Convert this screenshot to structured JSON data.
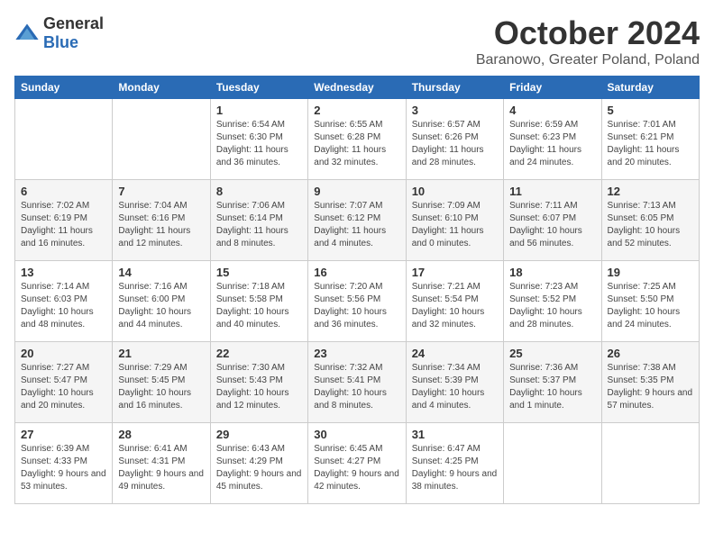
{
  "header": {
    "logo_general": "General",
    "logo_blue": "Blue",
    "month": "October 2024",
    "location": "Baranowo, Greater Poland, Poland"
  },
  "days_of_week": [
    "Sunday",
    "Monday",
    "Tuesday",
    "Wednesday",
    "Thursday",
    "Friday",
    "Saturday"
  ],
  "weeks": [
    [
      {
        "day": "",
        "info": ""
      },
      {
        "day": "",
        "info": ""
      },
      {
        "day": "1",
        "info": "Sunrise: 6:54 AM\nSunset: 6:30 PM\nDaylight: 11 hours and 36 minutes."
      },
      {
        "day": "2",
        "info": "Sunrise: 6:55 AM\nSunset: 6:28 PM\nDaylight: 11 hours and 32 minutes."
      },
      {
        "day": "3",
        "info": "Sunrise: 6:57 AM\nSunset: 6:26 PM\nDaylight: 11 hours and 28 minutes."
      },
      {
        "day": "4",
        "info": "Sunrise: 6:59 AM\nSunset: 6:23 PM\nDaylight: 11 hours and 24 minutes."
      },
      {
        "day": "5",
        "info": "Sunrise: 7:01 AM\nSunset: 6:21 PM\nDaylight: 11 hours and 20 minutes."
      }
    ],
    [
      {
        "day": "6",
        "info": "Sunrise: 7:02 AM\nSunset: 6:19 PM\nDaylight: 11 hours and 16 minutes."
      },
      {
        "day": "7",
        "info": "Sunrise: 7:04 AM\nSunset: 6:16 PM\nDaylight: 11 hours and 12 minutes."
      },
      {
        "day": "8",
        "info": "Sunrise: 7:06 AM\nSunset: 6:14 PM\nDaylight: 11 hours and 8 minutes."
      },
      {
        "day": "9",
        "info": "Sunrise: 7:07 AM\nSunset: 6:12 PM\nDaylight: 11 hours and 4 minutes."
      },
      {
        "day": "10",
        "info": "Sunrise: 7:09 AM\nSunset: 6:10 PM\nDaylight: 11 hours and 0 minutes."
      },
      {
        "day": "11",
        "info": "Sunrise: 7:11 AM\nSunset: 6:07 PM\nDaylight: 10 hours and 56 minutes."
      },
      {
        "day": "12",
        "info": "Sunrise: 7:13 AM\nSunset: 6:05 PM\nDaylight: 10 hours and 52 minutes."
      }
    ],
    [
      {
        "day": "13",
        "info": "Sunrise: 7:14 AM\nSunset: 6:03 PM\nDaylight: 10 hours and 48 minutes."
      },
      {
        "day": "14",
        "info": "Sunrise: 7:16 AM\nSunset: 6:00 PM\nDaylight: 10 hours and 44 minutes."
      },
      {
        "day": "15",
        "info": "Sunrise: 7:18 AM\nSunset: 5:58 PM\nDaylight: 10 hours and 40 minutes."
      },
      {
        "day": "16",
        "info": "Sunrise: 7:20 AM\nSunset: 5:56 PM\nDaylight: 10 hours and 36 minutes."
      },
      {
        "day": "17",
        "info": "Sunrise: 7:21 AM\nSunset: 5:54 PM\nDaylight: 10 hours and 32 minutes."
      },
      {
        "day": "18",
        "info": "Sunrise: 7:23 AM\nSunset: 5:52 PM\nDaylight: 10 hours and 28 minutes."
      },
      {
        "day": "19",
        "info": "Sunrise: 7:25 AM\nSunset: 5:50 PM\nDaylight: 10 hours and 24 minutes."
      }
    ],
    [
      {
        "day": "20",
        "info": "Sunrise: 7:27 AM\nSunset: 5:47 PM\nDaylight: 10 hours and 20 minutes."
      },
      {
        "day": "21",
        "info": "Sunrise: 7:29 AM\nSunset: 5:45 PM\nDaylight: 10 hours and 16 minutes."
      },
      {
        "day": "22",
        "info": "Sunrise: 7:30 AM\nSunset: 5:43 PM\nDaylight: 10 hours and 12 minutes."
      },
      {
        "day": "23",
        "info": "Sunrise: 7:32 AM\nSunset: 5:41 PM\nDaylight: 10 hours and 8 minutes."
      },
      {
        "day": "24",
        "info": "Sunrise: 7:34 AM\nSunset: 5:39 PM\nDaylight: 10 hours and 4 minutes."
      },
      {
        "day": "25",
        "info": "Sunrise: 7:36 AM\nSunset: 5:37 PM\nDaylight: 10 hours and 1 minute."
      },
      {
        "day": "26",
        "info": "Sunrise: 7:38 AM\nSunset: 5:35 PM\nDaylight: 9 hours and 57 minutes."
      }
    ],
    [
      {
        "day": "27",
        "info": "Sunrise: 6:39 AM\nSunset: 4:33 PM\nDaylight: 9 hours and 53 minutes."
      },
      {
        "day": "28",
        "info": "Sunrise: 6:41 AM\nSunset: 4:31 PM\nDaylight: 9 hours and 49 minutes."
      },
      {
        "day": "29",
        "info": "Sunrise: 6:43 AM\nSunset: 4:29 PM\nDaylight: 9 hours and 45 minutes."
      },
      {
        "day": "30",
        "info": "Sunrise: 6:45 AM\nSunset: 4:27 PM\nDaylight: 9 hours and 42 minutes."
      },
      {
        "day": "31",
        "info": "Sunrise: 6:47 AM\nSunset: 4:25 PM\nDaylight: 9 hours and 38 minutes."
      },
      {
        "day": "",
        "info": ""
      },
      {
        "day": "",
        "info": ""
      }
    ]
  ]
}
